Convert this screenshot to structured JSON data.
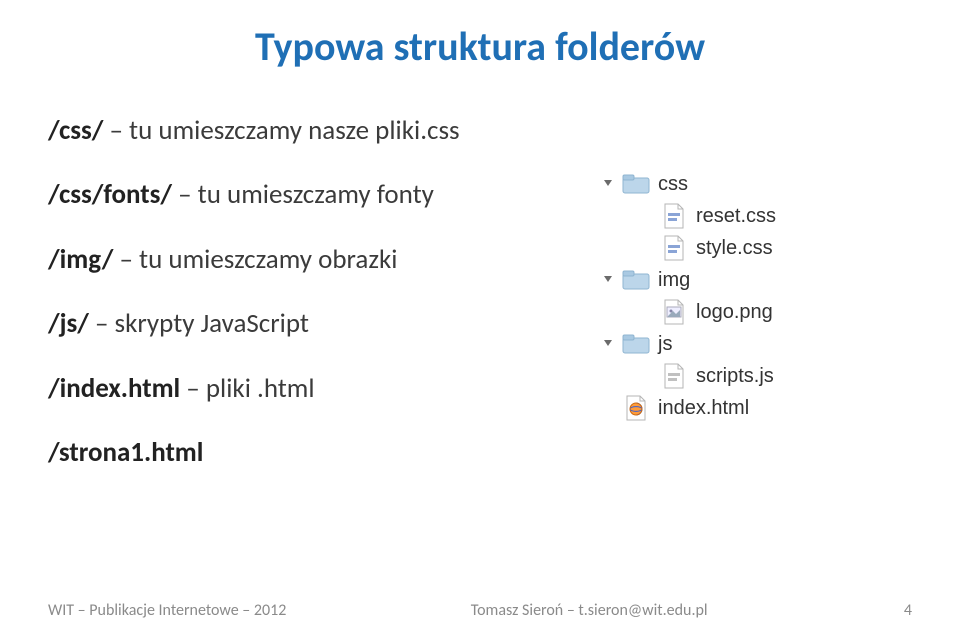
{
  "title": "Typowa struktura folderów",
  "left_items": [
    {
      "path": "/css/",
      "desc": " – tu umieszczamy nasze pliki.css"
    },
    {
      "path": "/css/fonts/",
      "desc": " – tu umieszczamy fonty"
    },
    {
      "path": "/img/",
      "desc": " – tu umieszczamy obrazki"
    },
    {
      "path": "/js/",
      "desc": " – skrypty JavaScript"
    },
    {
      "path": "/index.html",
      "desc": " – pliki .html"
    },
    {
      "path": "/strona1.html",
      "desc": ""
    }
  ],
  "tree": [
    {
      "depth": 0,
      "arrow": "down",
      "icon": "folder",
      "label": "css"
    },
    {
      "depth": 1,
      "arrow": "none",
      "icon": "css-file",
      "label": "reset.css"
    },
    {
      "depth": 1,
      "arrow": "none",
      "icon": "css-file",
      "label": "style.css"
    },
    {
      "depth": 0,
      "arrow": "down",
      "icon": "folder",
      "label": "img"
    },
    {
      "depth": 1,
      "arrow": "none",
      "icon": "img-file",
      "label": "logo.png"
    },
    {
      "depth": 0,
      "arrow": "down",
      "icon": "folder",
      "label": "js"
    },
    {
      "depth": 1,
      "arrow": "none",
      "icon": "js-file",
      "label": "scripts.js"
    },
    {
      "depth": 0,
      "arrow": "none_root",
      "icon": "html-file",
      "label": "index.html"
    }
  ],
  "footer": {
    "left": "WIT – Publikacje Internetowe – 2012",
    "center": "Tomasz Sieroń – t.sieron@wit.edu.pl",
    "right": "4"
  }
}
